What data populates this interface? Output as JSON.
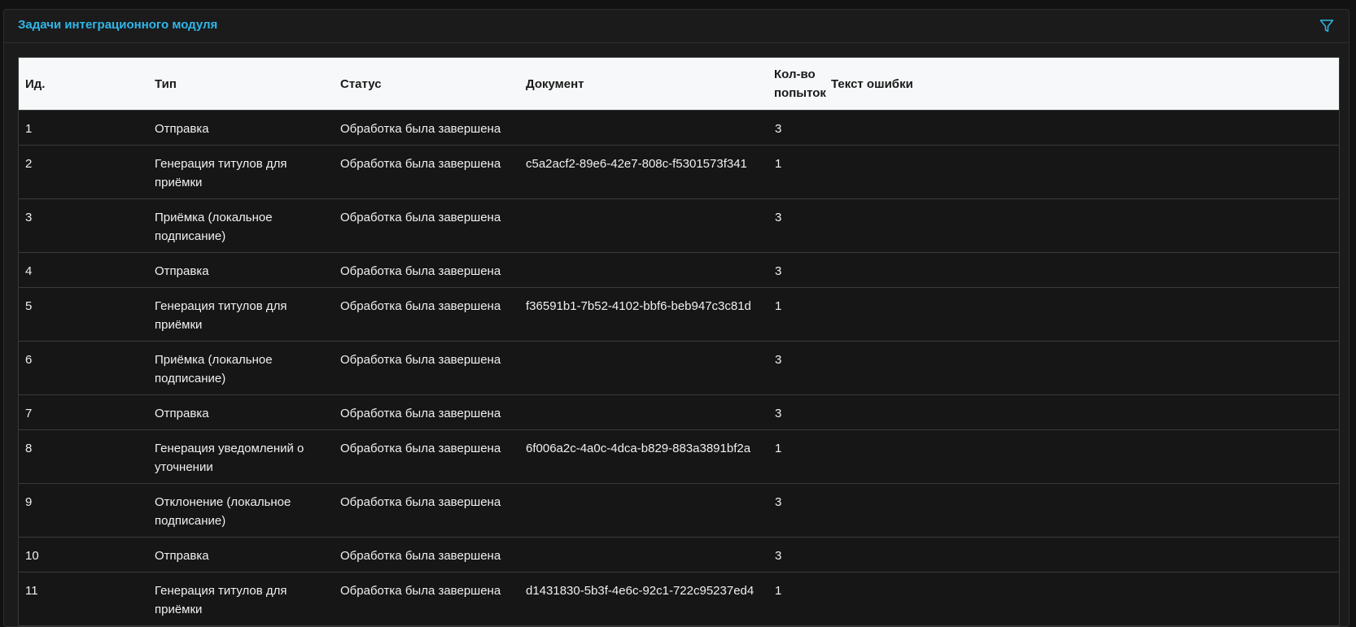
{
  "panel": {
    "title": "Задачи интеграционного модуля",
    "accent_color": "#2fb6e8",
    "filter_icon": "filter-icon"
  },
  "table": {
    "columns": [
      "Ид.",
      "Тип",
      "Статус",
      "Документ",
      "Кол-во попыток",
      "Текст ошибки"
    ],
    "rows": [
      {
        "id": "1",
        "type": "Отправка",
        "status": "Обработка была завершена",
        "document": "",
        "tries": "3",
        "error": ""
      },
      {
        "id": "2",
        "type": "Генерация титулов для приёмки",
        "status": "Обработка была завершена",
        "document": "c5a2acf2-89e6-42e7-808c-f5301573f341",
        "tries": "1",
        "error": ""
      },
      {
        "id": "3",
        "type": "Приёмка (локальное подписание)",
        "status": "Обработка была завершена",
        "document": "",
        "tries": "3",
        "error": ""
      },
      {
        "id": "4",
        "type": "Отправка",
        "status": "Обработка была завершена",
        "document": "",
        "tries": "3",
        "error": ""
      },
      {
        "id": "5",
        "type": "Генерация титулов для приёмки",
        "status": "Обработка была завершена",
        "document": "f36591b1-7b52-4102-bbf6-beb947c3c81d",
        "tries": "1",
        "error": ""
      },
      {
        "id": "6",
        "type": "Приёмка (локальное подписание)",
        "status": "Обработка была завершена",
        "document": "",
        "tries": "3",
        "error": ""
      },
      {
        "id": "7",
        "type": "Отправка",
        "status": "Обработка была завершена",
        "document": "",
        "tries": "3",
        "error": ""
      },
      {
        "id": "8",
        "type": "Генерация уведомлений о уточнении",
        "status": "Обработка была завершена",
        "document": "6f006a2c-4a0c-4dca-b829-883a3891bf2a",
        "tries": "1",
        "error": ""
      },
      {
        "id": "9",
        "type": "Отклонение (локальное подписание)",
        "status": "Обработка была завершена",
        "document": "",
        "tries": "3",
        "error": ""
      },
      {
        "id": "10",
        "type": "Отправка",
        "status": "Обработка была завершена",
        "document": "",
        "tries": "3",
        "error": ""
      },
      {
        "id": "11",
        "type": "Генерация титулов для приёмки",
        "status": "Обработка была завершена",
        "document": "d1431830-5b3f-4e6c-92c1-722c95237ed4",
        "tries": "1",
        "error": ""
      }
    ]
  }
}
